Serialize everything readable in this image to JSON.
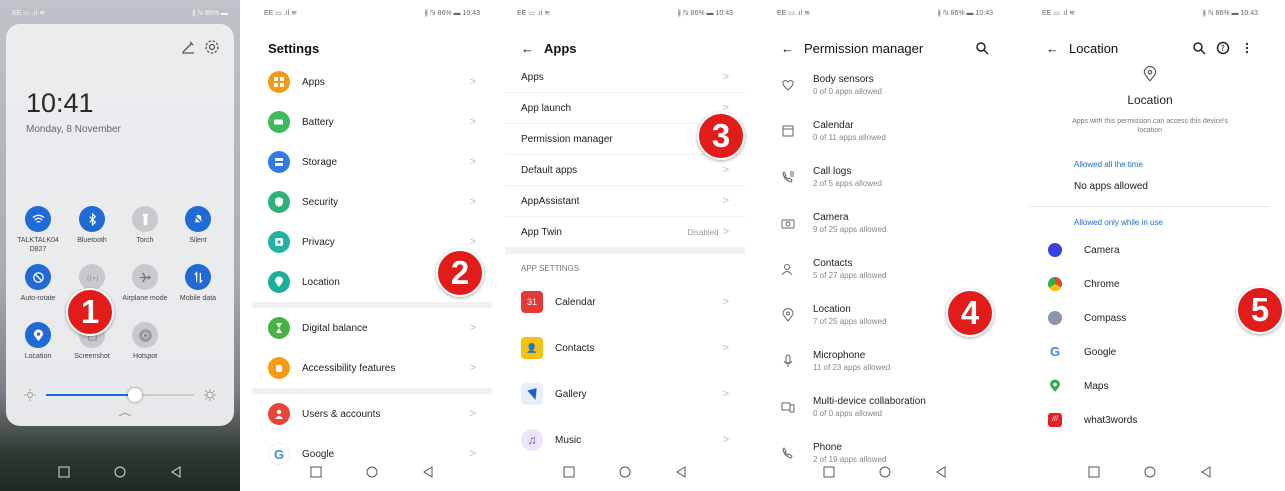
{
  "status_bar": {
    "carrier": "EE ▭ .ıl ≋",
    "battery": "∦ ℕ 86% ▬",
    "time": "10:43"
  },
  "panel1": {
    "clock": "10:41",
    "date": "Monday, 8 November",
    "tiles": [
      {
        "label": "TALKTALK04 D827",
        "icon": "wifi-icon",
        "on": true
      },
      {
        "label": "Bluetooth",
        "icon": "bluetooth-icon",
        "on": true
      },
      {
        "label": "Torch",
        "icon": "torch-icon",
        "on": false
      },
      {
        "label": "Silent",
        "icon": "bell-off-icon",
        "on": true
      },
      {
        "label": "Auto-rotate",
        "icon": "rotate-lock-icon",
        "on": true
      },
      {
        "label": "",
        "icon": "nfc-icon",
        "on": false
      },
      {
        "label": "Airplane mode",
        "icon": "airplane-icon",
        "on": false
      },
      {
        "label": "Mobile data",
        "icon": "mobile-data-icon",
        "on": true
      },
      {
        "label": "Location",
        "icon": "location-icon",
        "on": true
      },
      {
        "label": "Screenshot",
        "icon": "screenshot-icon",
        "on": false
      },
      {
        "label": "Hotspot",
        "icon": "hotspot-icon",
        "on": false
      }
    ],
    "brightness": 0.6
  },
  "panel2": {
    "title": "Settings",
    "items": [
      {
        "label": "Apps",
        "color": "#f39a1b"
      },
      {
        "label": "Battery",
        "color": "#3fba5a"
      },
      {
        "label": "Storage",
        "color": "#2f7be8"
      },
      {
        "label": "Security",
        "color": "#2bb47a"
      },
      {
        "label": "Privacy",
        "color": "#1fb4a5"
      },
      {
        "label": "Location",
        "color": "#1ab09a"
      },
      {
        "label": "Digital balance",
        "color": "#47b347"
      },
      {
        "label": "Accessibility features",
        "color": "#f59b16"
      },
      {
        "label": "Users & accounts",
        "color": "#e8443a"
      },
      {
        "label": "Google",
        "color": "#ffffff"
      }
    ]
  },
  "panel3": {
    "title": "Apps",
    "items": [
      {
        "label": "Apps",
        "sub": ""
      },
      {
        "label": "App launch",
        "sub": ""
      },
      {
        "label": "Permission manager",
        "sub": ""
      },
      {
        "label": "Default apps",
        "sub": ""
      },
      {
        "label": "AppAssistant",
        "sub": ""
      },
      {
        "label": "App Twin",
        "sub": "Disabled"
      }
    ],
    "section": "APP SETTINGS",
    "app_settings": [
      {
        "label": "Calendar",
        "color": "#e53935",
        "glyph": "31"
      },
      {
        "label": "Contacts",
        "color": "#f6c20f",
        "glyph": "👤"
      },
      {
        "label": "Gallery",
        "color": "#e6f0fa",
        "glyph": ""
      },
      {
        "label": "Music",
        "color": "#ece6fb",
        "glyph": "♫"
      }
    ]
  },
  "panel4": {
    "title": "Permission manager",
    "items": [
      {
        "label": "Body sensors",
        "sub": "0 of 0 apps allowed"
      },
      {
        "label": "Calendar",
        "sub": "0 of 11 apps allowed"
      },
      {
        "label": "Call logs",
        "sub": "2 of 5 apps allowed"
      },
      {
        "label": "Camera",
        "sub": "9 of 25 apps allowed"
      },
      {
        "label": "Contacts",
        "sub": "5 of 27 apps allowed"
      },
      {
        "label": "Location",
        "sub": "7 of 25 apps allowed"
      },
      {
        "label": "Microphone",
        "sub": "11 of 23 apps allowed"
      },
      {
        "label": "Multi-device collaboration",
        "sub": "0 of 0 apps allowed"
      },
      {
        "label": "Phone",
        "sub": "2 of 19 apps allowed"
      }
    ]
  },
  "panel5": {
    "title": "Location",
    "heading": "Location",
    "desc": "Apps with this permission can access this device's location",
    "allowed_all": "Allowed all the time",
    "no_apps": "No apps allowed",
    "allowed_use": "Allowed only while in use",
    "apps": [
      {
        "label": "Camera",
        "color": "#3b3fe0"
      },
      {
        "label": "Chrome",
        "color": "#e24a2c"
      },
      {
        "label": "Compass",
        "color": "#8a95a6"
      },
      {
        "label": "Google",
        "color": "#4285f4"
      },
      {
        "label": "Maps",
        "color": "#34a853"
      },
      {
        "label": "what3words",
        "color": "#e11f26"
      }
    ]
  },
  "badges": [
    "1",
    "2",
    "3",
    "4",
    "5"
  ]
}
